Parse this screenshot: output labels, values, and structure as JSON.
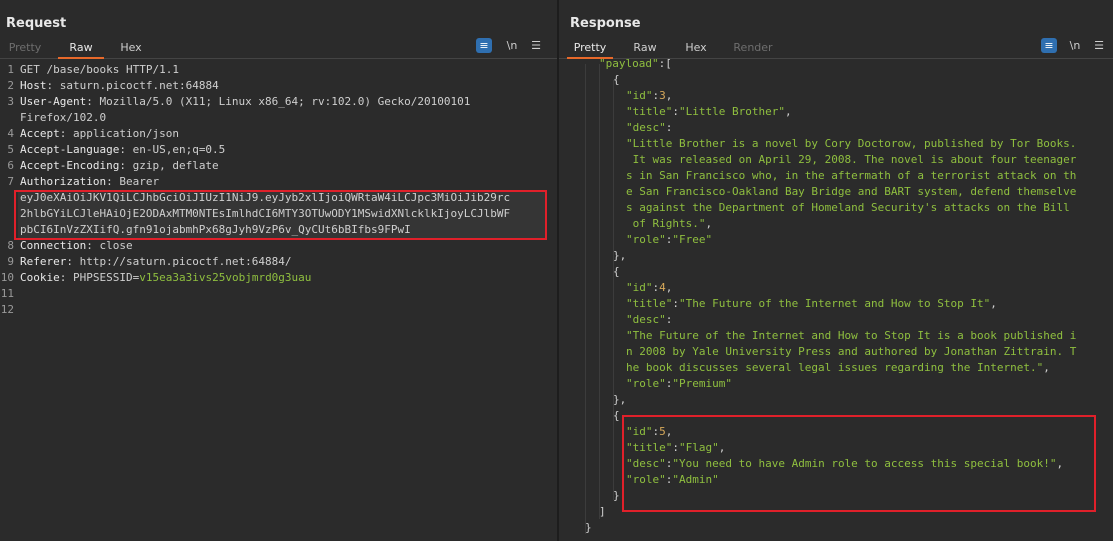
{
  "layout_ids": {
    "view_toggle": [
      "view-split-icon",
      "view-horizontal-icon",
      "view-vertical-icon"
    ]
  },
  "request": {
    "title": "Request",
    "tabs": [
      "Pretty",
      "Raw",
      "Hex"
    ],
    "active_tab": "Raw",
    "tools": {
      "wrap_icon": "wrap-icon",
      "newline_label": "\\n",
      "menu_icon": "menu-icon"
    },
    "lines": [
      {
        "n": "1",
        "key": "",
        "val": "GET /base/books HTTP/1.1"
      },
      {
        "n": "2",
        "key": "Host",
        "val": ": saturn.picoctf.net:64884"
      },
      {
        "n": "3",
        "key": "User-Agent",
        "val": ": Mozilla/5.0 (X11; Linux x86_64; rv:102.0) Gecko/20100101"
      },
      {
        "n": "",
        "key": "",
        "val": "Firefox/102.0"
      },
      {
        "n": "4",
        "key": "Accept",
        "val": ": application/json"
      },
      {
        "n": "5",
        "key": "Accept-Language",
        "val": ": en-US,en;q=0.5"
      },
      {
        "n": "6",
        "key": "Accept-Encoding",
        "val": ": gzip, deflate"
      },
      {
        "n": "7",
        "key": "Authorization",
        "val": ": Bearer"
      },
      {
        "n": "",
        "key": "",
        "val": "eyJ0eXAiOiJKV1QiLCJhbGciOiJIUzI1NiJ9.eyJyb2xlIjoiQWRtaW4iLCJpc3MiOiJib29rc"
      },
      {
        "n": "",
        "key": "",
        "val": "2hlbGYiLCJleHAiOjE2ODAxMTM0NTEsImlhdCI6MTY3OTUwODY1MSwidXNlcklkIjoyLCJlbWF"
      },
      {
        "n": "",
        "key": "",
        "val": "pbCI6InVzZXIifQ.gfn91ojabmhPx68gJyh9VzP6v_QyCUt6bBIfbs9FPwI"
      },
      {
        "n": "8",
        "key": "Connection",
        "val": ": close"
      },
      {
        "n": "9",
        "key": "Referer",
        "val": ": http://saturn.picoctf.net:64884/"
      },
      {
        "n": "10",
        "key": "Cookie",
        "val": ": PHPSESSID=",
        "extra": "v15ea3a3ivs25vobjmrd0g3uau"
      },
      {
        "n": "11",
        "key": "",
        "val": ""
      },
      {
        "n": "12",
        "key": "",
        "val": ""
      }
    ]
  },
  "response": {
    "title": "Response",
    "tabs": [
      "Pretty",
      "Raw",
      "Hex",
      "Render"
    ],
    "active_tab": "Pretty",
    "tools": {
      "wrap_icon": "wrap-icon",
      "newline_label": "\\n",
      "menu_icon": "menu-icon"
    },
    "lines": [
      {
        "indent": 2,
        "parts": [
          [
            "jk",
            "\"payload\""
          ],
          [
            "jp",
            ":["
          ]
        ]
      },
      {
        "indent": 3,
        "parts": [
          [
            "jp",
            "{"
          ]
        ]
      },
      {
        "indent": 4,
        "parts": [
          [
            "jk",
            "\"id\""
          ],
          [
            "jp",
            ":"
          ],
          [
            "jn",
            "3"
          ],
          [
            "jp",
            ","
          ]
        ]
      },
      {
        "indent": 4,
        "parts": [
          [
            "jk",
            "\"title\""
          ],
          [
            "jp",
            ":"
          ],
          [
            "jk",
            "\"Little Brother\""
          ],
          [
            "jp",
            ","
          ]
        ]
      },
      {
        "indent": 4,
        "parts": [
          [
            "jk",
            "\"desc\""
          ],
          [
            "jp",
            ":"
          ]
        ]
      },
      {
        "indent": 4,
        "parts": [
          [
            "jk",
            "\"Little Brother is a novel by Cory Doctorow, published by Tor Books."
          ]
        ]
      },
      {
        "indent": 4,
        "parts": [
          [
            "jk",
            " It was released on April 29, 2008. The novel is about four teenager"
          ]
        ]
      },
      {
        "indent": 4,
        "parts": [
          [
            "jk",
            "s in San Francisco who, in the aftermath of a terrorist attack on th"
          ]
        ]
      },
      {
        "indent": 4,
        "parts": [
          [
            "jk",
            "e San Francisco-Oakland Bay Bridge and BART system, defend themselve"
          ]
        ]
      },
      {
        "indent": 4,
        "parts": [
          [
            "jk",
            "s against the Department of Homeland Security's attacks on the Bill"
          ]
        ]
      },
      {
        "indent": 4,
        "parts": [
          [
            "jk",
            " of Rights.\""
          ],
          [
            "jp",
            ","
          ]
        ]
      },
      {
        "indent": 4,
        "parts": [
          [
            "jk",
            "\"role\""
          ],
          [
            "jp",
            ":"
          ],
          [
            "jk",
            "\"Free\""
          ]
        ]
      },
      {
        "indent": 3,
        "parts": [
          [
            "jp",
            "},"
          ]
        ]
      },
      {
        "indent": 3,
        "parts": [
          [
            "jp",
            "{"
          ]
        ]
      },
      {
        "indent": 4,
        "parts": [
          [
            "jk",
            "\"id\""
          ],
          [
            "jp",
            ":"
          ],
          [
            "jn",
            "4"
          ],
          [
            "jp",
            ","
          ]
        ]
      },
      {
        "indent": 4,
        "parts": [
          [
            "jk",
            "\"title\""
          ],
          [
            "jp",
            ":"
          ],
          [
            "jk",
            "\"The Future of the Internet and How to Stop It\""
          ],
          [
            "jp",
            ","
          ]
        ]
      },
      {
        "indent": 4,
        "parts": [
          [
            "jk",
            "\"desc\""
          ],
          [
            "jp",
            ":"
          ]
        ]
      },
      {
        "indent": 4,
        "parts": [
          [
            "jk",
            "\"The Future of the Internet and How to Stop It is a book published i"
          ]
        ]
      },
      {
        "indent": 4,
        "parts": [
          [
            "jk",
            "n 2008 by Yale University Press and authored by Jonathan Zittrain. T"
          ]
        ]
      },
      {
        "indent": 4,
        "parts": [
          [
            "jk",
            "he book discusses several legal issues regarding the Internet.\""
          ],
          [
            "jp",
            ","
          ]
        ]
      },
      {
        "indent": 4,
        "parts": [
          [
            "jk",
            "\"role\""
          ],
          [
            "jp",
            ":"
          ],
          [
            "jk",
            "\"Premium\""
          ]
        ]
      },
      {
        "indent": 3,
        "parts": [
          [
            "jp",
            "},"
          ]
        ]
      },
      {
        "indent": 3,
        "parts": [
          [
            "jp",
            "{"
          ]
        ]
      },
      {
        "indent": 4,
        "parts": [
          [
            "jk",
            "\"id\""
          ],
          [
            "jp",
            ":"
          ],
          [
            "jn",
            "5"
          ],
          [
            "jp",
            ","
          ]
        ]
      },
      {
        "indent": 4,
        "parts": [
          [
            "jk",
            "\"title\""
          ],
          [
            "jp",
            ":"
          ],
          [
            "jk",
            "\"Flag\""
          ],
          [
            "jp",
            ","
          ]
        ]
      },
      {
        "indent": 4,
        "parts": [
          [
            "jk",
            "\"desc\""
          ],
          [
            "jp",
            ":"
          ],
          [
            "jk",
            "\"You need to have Admin role to access this special book!\""
          ],
          [
            "jp",
            ","
          ]
        ]
      },
      {
        "indent": 4,
        "parts": [
          [
            "jk",
            "\"role\""
          ],
          [
            "jp",
            ":"
          ],
          [
            "jk",
            "\"Admin\""
          ]
        ]
      },
      {
        "indent": 3,
        "parts": [
          [
            "jp",
            "}"
          ]
        ]
      },
      {
        "indent": 2,
        "parts": [
          [
            "jp",
            "]"
          ]
        ]
      },
      {
        "indent": 1,
        "parts": [
          [
            "jp",
            "}"
          ]
        ]
      }
    ]
  },
  "colors": {
    "accent": "#e8692a",
    "highlight": "#e0202a",
    "toggle_active": "#2f6fb0",
    "string": "#8fbf3f",
    "number": "#d6a85a"
  }
}
